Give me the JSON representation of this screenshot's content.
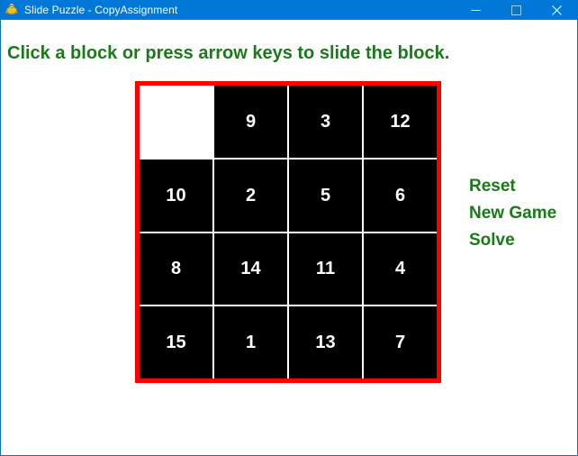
{
  "window": {
    "title": "Slide Puzzle - CopyAssignment",
    "icon": "python-turtle-icon",
    "controls": [
      {
        "name": "minimize-button",
        "icon": "minimize-icon",
        "label": "—"
      },
      {
        "name": "maximize-button",
        "icon": "maximize-icon",
        "label": "□"
      },
      {
        "name": "close-button",
        "icon": "close-icon",
        "label": "✕"
      }
    ]
  },
  "header": {
    "instruction": "Click a block or press arrow keys to slide the block."
  },
  "board": {
    "rows": 4,
    "cols": 4,
    "border_color": "#ff0000",
    "tile_color": "#000000",
    "tile_text_color": "#ffffff",
    "blank_color": "#ffffff",
    "tiles": [
      {
        "label": "",
        "blank": true
      },
      {
        "label": "9",
        "blank": false
      },
      {
        "label": "3",
        "blank": false
      },
      {
        "label": "12",
        "blank": false
      },
      {
        "label": "10",
        "blank": false
      },
      {
        "label": "2",
        "blank": false
      },
      {
        "label": "5",
        "blank": false
      },
      {
        "label": "6",
        "blank": false
      },
      {
        "label": "8",
        "blank": false
      },
      {
        "label": "14",
        "blank": false
      },
      {
        "label": "11",
        "blank": false
      },
      {
        "label": "4",
        "blank": false
      },
      {
        "label": "15",
        "blank": false
      },
      {
        "label": "1",
        "blank": false
      },
      {
        "label": "13",
        "blank": false
      },
      {
        "label": "7",
        "blank": false
      }
    ]
  },
  "menu": {
    "color": "#1a7a1a",
    "items": [
      {
        "label": "Reset"
      },
      {
        "label": "New Game"
      },
      {
        "label": "Solve"
      }
    ]
  }
}
